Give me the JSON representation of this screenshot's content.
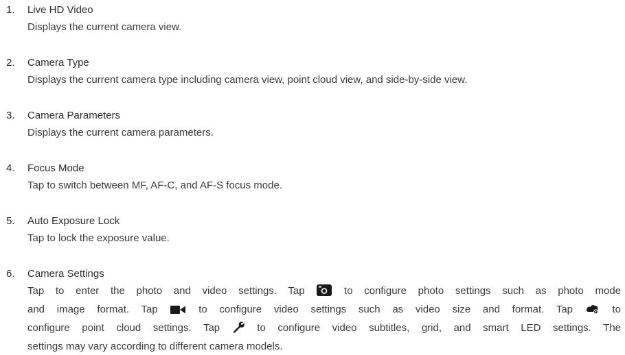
{
  "items": [
    {
      "number": "1.",
      "title": "Live HD Video",
      "description": "Displays the current camera view."
    },
    {
      "number": "2.",
      "title": "Camera Type",
      "description": "Displays the current camera type including camera view, point cloud view, and side-by-side view."
    },
    {
      "number": "3.",
      "title": "Camera Parameters",
      "description": "Displays the current camera parameters."
    },
    {
      "number": "4.",
      "title": "Focus Mode",
      "description": "Tap to switch between MF, AF-C, and AF-S focus mode."
    },
    {
      "number": "5.",
      "title": "Auto Exposure Lock",
      "description": "Tap to lock the exposure value."
    },
    {
      "number": "6.",
      "title": "Camera Settings",
      "description_segments": {
        "s1": "Tap to enter the photo and video settings. Tap",
        "s2": "to configure photo settings such as photo mode",
        "s3": "and image format. Tap",
        "s4": "to configure video settings such as video size and format. Tap",
        "s5": "to",
        "s6": "configure point cloud settings. Tap",
        "s7": "to configure video subtitles, grid, and smart LED settings. The",
        "s8": "settings may vary according to different camera models."
      },
      "icons": [
        "camera-icon",
        "video-camera-icon",
        "point-cloud-icon",
        "wrench-icon"
      ]
    }
  ]
}
